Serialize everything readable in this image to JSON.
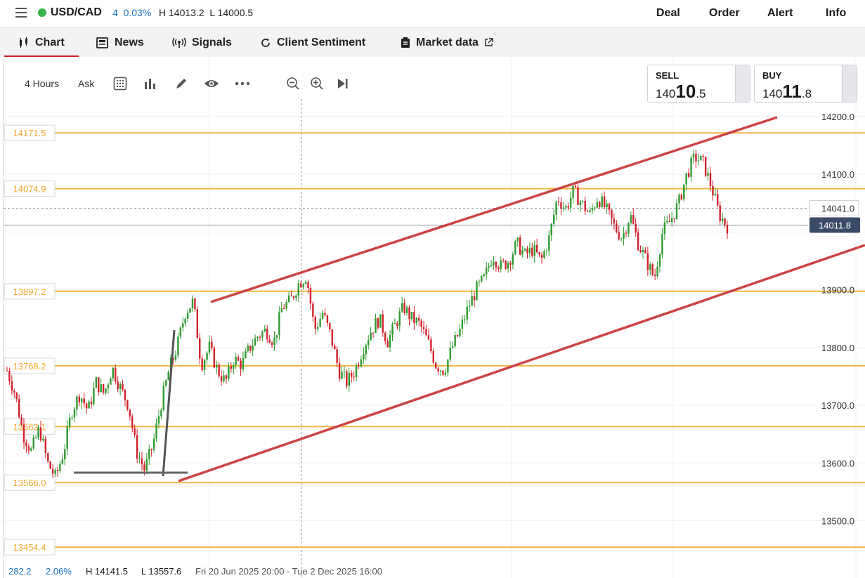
{
  "header": {
    "symbol": "USD/CAD",
    "change": "4",
    "change_pct": "0.03%",
    "high": "H 14013.2",
    "low": "L 14000.5",
    "nav": [
      "Deal",
      "Order",
      "Alert",
      "Info"
    ]
  },
  "tabs": [
    {
      "label": "Chart",
      "icon": "candlestick-icon"
    },
    {
      "label": "News",
      "icon": "newspaper-icon"
    },
    {
      "label": "Signals",
      "icon": "broadcast-icon"
    },
    {
      "label": "Client Sentiment",
      "icon": "refresh-icon"
    },
    {
      "label": "Market data",
      "icon": "clipboard-icon",
      "external_icon": "external-link-icon"
    }
  ],
  "toolbar": {
    "interval": "4 Hours",
    "price_type": "Ask",
    "icons": [
      "calculator-icon",
      "bar-chart-icon",
      "pencil-icon",
      "eye-icon",
      "more-icon",
      "zoom-out-icon",
      "zoom-in-icon",
      "skip-to-end-icon"
    ]
  },
  "trade": {
    "sell": {
      "label": "SELL",
      "prefix": "140",
      "big": "10",
      "suffix": ".5"
    },
    "buy": {
      "label": "BUY",
      "prefix": "140",
      "big": "11",
      "suffix": ".8"
    }
  },
  "bottom": {
    "value": "282.2",
    "pct": "2.06%",
    "high": "H 14141.5",
    "low": "L 13557.6",
    "range": "Fri 20 Jun 2025 20:00 - Tue 2 Dec 2025 16:00"
  },
  "colors": {
    "up": "#2e9a2e",
    "down": "#d0202a",
    "level_line": "#f5b640",
    "trend": "#cc4444",
    "live": "#37b24d",
    "change": "#1a73c8",
    "price_tag": "#3b4a66",
    "tab_active": "#d0202a"
  },
  "chart_data": {
    "type": "candlestick",
    "ylim": [
      13430,
      14240
    ],
    "y_ticks": [
      "14200.0",
      "14100.0",
      "14041.0",
      "13900.0",
      "13800.0",
      "13700.0",
      "13600.0",
      "13500.0"
    ],
    "current_price": "14011.8",
    "crosshair_price": "14041.0",
    "levels": [
      "14171.5",
      "14074.9",
      "13897.2",
      "13768.2",
      "13663.1",
      "13566.0",
      "13454.4"
    ],
    "close_path": [
      13760,
      13720,
      13650,
      13620,
      13660,
      13600,
      13575,
      13620,
      13690,
      13720,
      13690,
      13740,
      13720,
      13765,
      13730,
      13700,
      13620,
      13588,
      13630,
      13700,
      13760,
      13800,
      13860,
      13880,
      13770,
      13800,
      13760,
      13740,
      13780,
      13770,
      13800,
      13820,
      13830,
      13810,
      13870,
      13880,
      13910,
      13925,
      13830,
      13860,
      13820,
      13760,
      13740,
      13760,
      13800,
      13830,
      13850,
      13810,
      13840,
      13870,
      13850,
      13840,
      13810,
      13770,
      13760,
      13800,
      13830,
      13870,
      13900,
      13920,
      13960,
      13940,
      13950,
      13980,
      13960,
      13970,
      13950,
      13990,
      14060,
      14040,
      14070,
      14050,
      14030,
      14060,
      14040,
      14010,
      13990,
      14030,
      13980,
      13950,
      13920,
      14000,
      14020,
      14050,
      14100,
      14130,
      14120,
      14080,
      14030,
      14010
    ]
  }
}
